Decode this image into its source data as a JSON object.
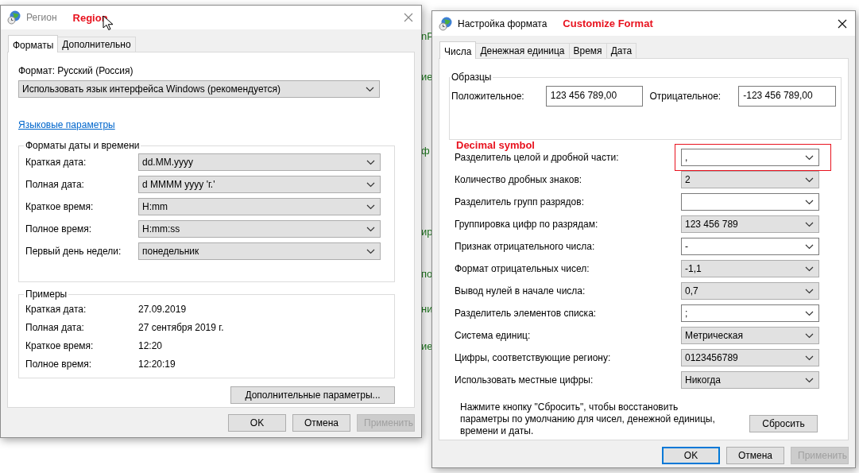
{
  "background_text": [
    "nP",
    "ие",
    "ф",
    "ир",
    "по",
    "ни",
    "ие"
  ],
  "region_window": {
    "title": "Регион",
    "active": false,
    "annotation": "Region",
    "tabs": [
      {
        "label": "Форматы",
        "selected": true
      },
      {
        "label": "Дополнительно",
        "selected": false
      }
    ],
    "format_label": "Формат: Русский (Россия)",
    "format_dropdown": "Использовать язык интерфейса Windows (рекомендуется)",
    "language_link": "Языковые параметры",
    "date_time_formats": {
      "title": "Форматы даты и времени",
      "rows": [
        {
          "label": "Краткая дата:",
          "value": "dd.MM.yyyy"
        },
        {
          "label": "Полная дата:",
          "value": "d MMMM yyyy 'г.'"
        },
        {
          "label": "Краткое время:",
          "value": "H:mm"
        },
        {
          "label": "Полное время:",
          "value": "H:mm:ss"
        },
        {
          "label": "Первый день недели:",
          "value": "понедельник"
        }
      ]
    },
    "examples": {
      "title": "Примеры",
      "rows": [
        {
          "label": "Краткая дата:",
          "value": "27.09.2019"
        },
        {
          "label": "Полная дата:",
          "value": "27 сентября 2019 г."
        },
        {
          "label": "Краткое время:",
          "value": "12:20"
        },
        {
          "label": "Полное время:",
          "value": "12:20:19"
        }
      ]
    },
    "more_button": "Дополнительные параметры...",
    "buttons": [
      {
        "label": "OK",
        "default": false,
        "disabled": false
      },
      {
        "label": "Отмена",
        "default": false,
        "disabled": false
      },
      {
        "label": "Применить",
        "default": false,
        "disabled": true
      }
    ]
  },
  "format_window": {
    "title": "Настройка формата",
    "active": true,
    "annotation": "Customize Format",
    "tabs": [
      {
        "label": "Числа",
        "selected": true
      },
      {
        "label": "Денежная единица",
        "selected": false
      },
      {
        "label": "Время",
        "selected": false
      },
      {
        "label": "Дата",
        "selected": false
      }
    ],
    "samples": {
      "title": "Образцы",
      "positive_label": "Положительное:",
      "positive_value": "123 456 789,00",
      "negative_label": "Отрицательное:",
      "negative_value": "-123 456 789,00"
    },
    "callout": "Decimal symbol",
    "settings": [
      {
        "label": "Разделитель целой и дробной части:",
        "value": ",",
        "kind": "editable",
        "highlighted": true
      },
      {
        "label": "Количество дробных знаков:",
        "value": "2",
        "kind": "dropdown",
        "highlighted": false
      },
      {
        "label": "Разделитель групп разрядов:",
        "kind": "editable",
        "highlighted": false
      },
      {
        "label": "Группировка цифр по разрядам:",
        "value": "123 456 789",
        "kind": "dropdown",
        "highlighted": false
      },
      {
        "label": "Признак отрицательного числа:",
        "value": "-",
        "kind": "editable",
        "highlighted": false
      },
      {
        "label": "Формат отрицательных чисел:",
        "value": "-1,1",
        "kind": "dropdown",
        "highlighted": false
      },
      {
        "label": "Вывод нулей в начале числа:",
        "value": "0,7",
        "kind": "dropdown",
        "highlighted": false
      },
      {
        "label": "Разделитель элементов списка:",
        "value": ";",
        "kind": "editable",
        "highlighted": false
      },
      {
        "label": "Система единиц:",
        "value": "Метрическая",
        "kind": "dropdown",
        "highlighted": false
      },
      {
        "label": "Цифры, соответствующие региону:",
        "value": "0123456789",
        "kind": "dropdown",
        "highlighted": false
      },
      {
        "label": "Использовать местные цифры:",
        "value": "Никогда",
        "kind": "dropdown",
        "highlighted": false
      }
    ],
    "note": "Нажмите кнопку \"Сбросить\", чтобы восстановить\nпараметры по умолчанию для чисел, денежной единицы,\nвремени и даты.",
    "reset_button": "Сбросить",
    "buttons": [
      {
        "label": "OK",
        "default": true,
        "disabled": false
      },
      {
        "label": "Отмена",
        "default": false,
        "disabled": false
      },
      {
        "label": "Применить",
        "default": false,
        "disabled": true
      }
    ]
  }
}
